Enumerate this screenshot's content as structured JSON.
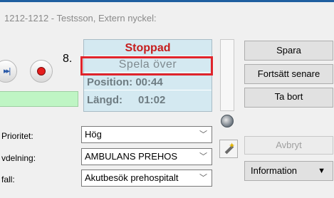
{
  "window": {
    "title": "1212-1212 - Testsson, Extern nyckel:"
  },
  "player": {
    "next_glyph": "▸▸|",
    "step_number": "8."
  },
  "status_panel": {
    "state": "Stoppad",
    "replay": "Spela över",
    "position_text": "Position: 00:44",
    "length_label": "Längd:",
    "length_value": "01:02",
    "state_color": "#c61d1d",
    "highlight_color": "#e0242b"
  },
  "buttons": {
    "save": "Spara",
    "continue_later": "Fortsätt senare",
    "delete": "Ta bort",
    "cancel": "Avbryt",
    "information": "Information",
    "information_arrow": "▼"
  },
  "form": {
    "priority_label": "Prioritet:",
    "priority_value": "Hög",
    "department_label": "vdelning:",
    "department_value": "AMBULANS PREHOS",
    "case_label": "fall:",
    "case_value": "Akutbesök prehospitalt",
    "chevron": "﹀"
  },
  "icons": {
    "next": "next-track-icon",
    "record": "record-icon",
    "phone": "phone-icon",
    "wand": "magic-wand-icon"
  }
}
